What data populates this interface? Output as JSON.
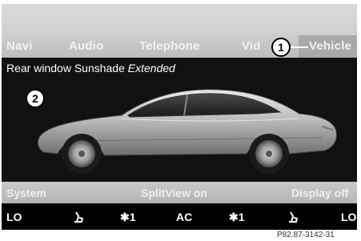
{
  "menu": {
    "items": [
      "Navi",
      "Audio",
      "Telephone",
      "Vid",
      "Vehicle"
    ]
  },
  "status": {
    "label": "Rear window Sunshade ",
    "value": "Extended"
  },
  "callouts": [
    "1",
    "2"
  ],
  "bottom_bar": {
    "system": "System",
    "splitview": "SplitView on",
    "display": "Display off"
  },
  "climate": {
    "lo_left": "LO",
    "seat_left_icon": "seat-heat-icon",
    "fan_left": "✱1",
    "ac": "AC",
    "fan_right": "✱1",
    "seat_right_icon": "seat-heat-icon",
    "lo_right": "LO"
  },
  "caption": "P82.87-3142-31",
  "colors": {
    "menu_bar": "#c4c4c4",
    "active_tab": "#a9a9a9",
    "screen_bg": "#000000"
  }
}
